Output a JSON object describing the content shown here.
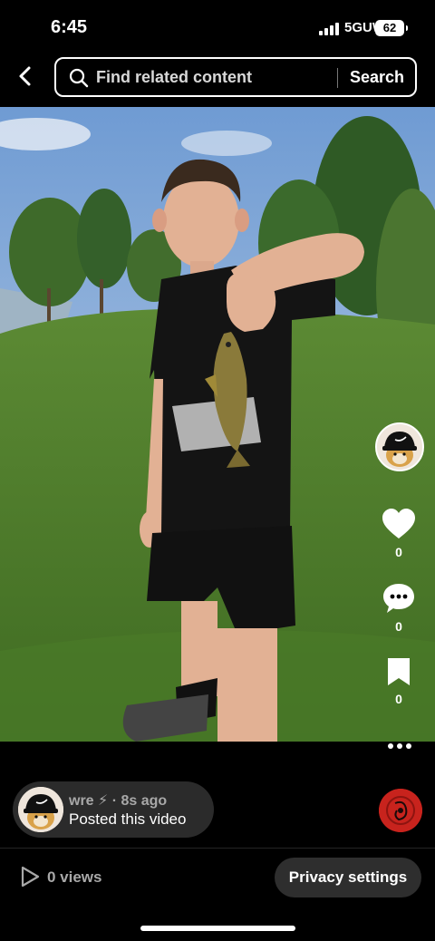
{
  "status_bar": {
    "time": "6:45",
    "network": "5GUW",
    "battery": "62"
  },
  "search": {
    "placeholder": "Find related content",
    "button_label": "Search"
  },
  "actions": {
    "likes": "0",
    "comments": "0",
    "saves": "0"
  },
  "post": {
    "username": "wre ⚡ · 8s ago",
    "caption": "Posted this video"
  },
  "footer": {
    "views": "0 views",
    "privacy_label": "Privacy settings"
  },
  "icons": {
    "back": "chevron-left-icon",
    "search": "search-icon",
    "like": "heart-icon",
    "comment": "comment-icon",
    "save": "bookmark-icon",
    "more": "more-dots-icon",
    "views": "play-icon"
  },
  "colors": {
    "background": "#000000",
    "pill": "#2b2b2b",
    "muted_text": "#a8a8a8",
    "music_disc": "#c8231d"
  }
}
